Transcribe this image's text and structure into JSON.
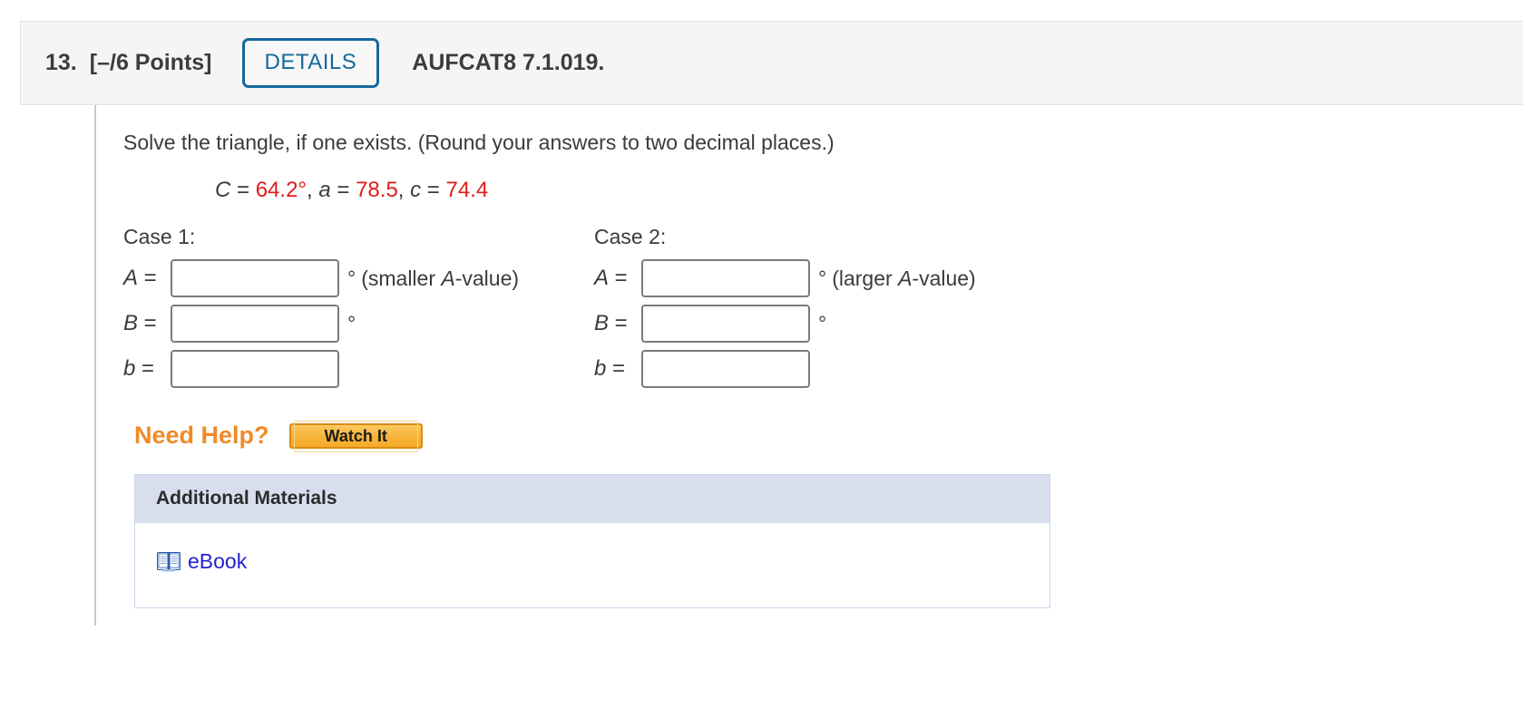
{
  "header": {
    "question_number": "13.",
    "points": "[–/6 Points]",
    "details_label": "DETAILS",
    "textbook_code": "AUFCAT8 7.1.019."
  },
  "question": {
    "prompt": "Solve the triangle, if one exists. (Round your answers to two decimal places.)",
    "given": {
      "angle_c_label": "C",
      "angle_c_value": "64.2°",
      "side_a_label": "a",
      "side_a_value": "78.5",
      "side_c_label": "c",
      "side_c_value": "74.4",
      "equals": "=",
      "comma": ", "
    },
    "value_color": "#e01b1b"
  },
  "cases": [
    {
      "title": "Case 1:",
      "fields": [
        {
          "label": "A",
          "equals": "=",
          "value": "",
          "placeholder": "",
          "unit": "°",
          "hint": "(smaller A-value)",
          "hint_pre": "(smaller ",
          "hint_var": "A",
          "hint_post": "-value)"
        },
        {
          "label": "B",
          "equals": "=",
          "value": "",
          "placeholder": "",
          "unit": "°",
          "hint": ""
        },
        {
          "label": "b",
          "equals": "=",
          "value": "",
          "placeholder": "",
          "unit": "",
          "hint": ""
        }
      ]
    },
    {
      "title": "Case 2:",
      "fields": [
        {
          "label": "A",
          "equals": "=",
          "value": "",
          "placeholder": "",
          "unit": "°",
          "hint": "(larger A-value)",
          "hint_pre": "(larger ",
          "hint_var": "A",
          "hint_post": "-value)"
        },
        {
          "label": "B",
          "equals": "=",
          "value": "",
          "placeholder": "",
          "unit": "°",
          "hint": ""
        },
        {
          "label": "b",
          "equals": "=",
          "value": "",
          "placeholder": "",
          "unit": "",
          "hint": ""
        }
      ]
    }
  ],
  "help": {
    "label": "Need Help?",
    "watch_it_label": "Watch It",
    "label_color": "#f08b28"
  },
  "additional_materials": {
    "header": "Additional Materials",
    "links": [
      {
        "icon": "book-icon",
        "label": "eBook"
      }
    ],
    "header_bg": "#d9deef",
    "link_color": "#2222cc"
  }
}
